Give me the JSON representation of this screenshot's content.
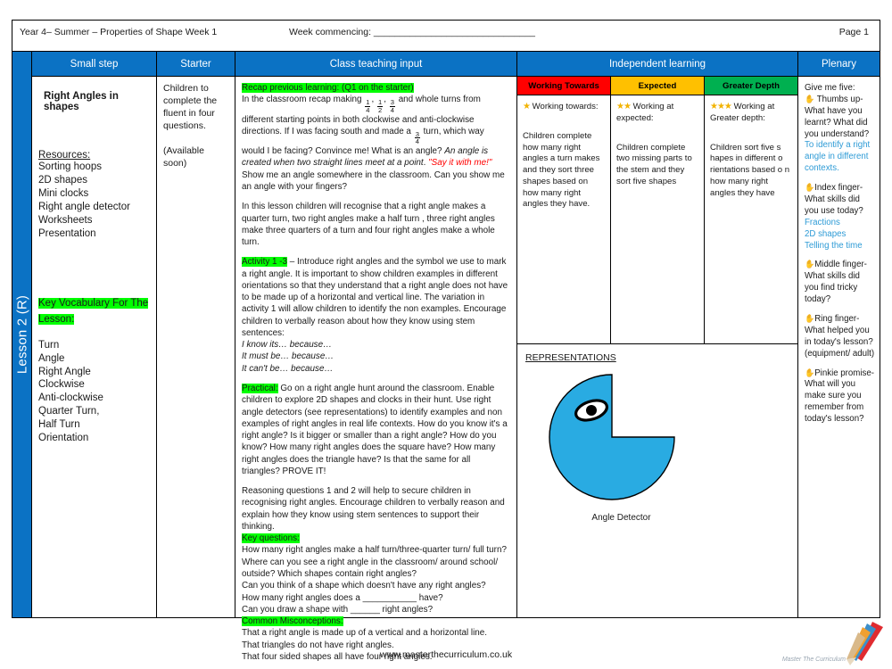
{
  "header": {
    "left": "Year 4– Summer – Properties of Shape Week 1",
    "middle": "Week commencing: _______________________________",
    "right": "Page 1"
  },
  "spine": {
    "label": "Lesson 2 (R)"
  },
  "columns": {
    "small_step": "Small step",
    "starter": "Starter",
    "class_teaching_input": "Class teaching input",
    "independent_learning": "Independent learning",
    "plenary": "Plenary"
  },
  "small_step": {
    "title": "Right Angles in shapes",
    "resources_heading": "Resources:",
    "resources": [
      "Sorting hoops",
      "2D shapes",
      "Mini clocks",
      "Right angle detector",
      "Worksheets",
      "Presentation"
    ],
    "vocab_heading": "Key Vocabulary For The Lesson:",
    "vocab": [
      "Turn",
      "Angle",
      "Right Angle",
      "Clockwise",
      "Anti-clockwise",
      "Quarter Turn,",
      "Half Turn",
      "Orientation"
    ]
  },
  "starter": {
    "text": "Children to complete the fluent in four questions.",
    "availability": "(Available soon)"
  },
  "teaching": {
    "recap_label": "Recap previous learning: (Q1 on the starter)",
    "recap_a": "In the classroom recap making",
    "frac1": {
      "num": "1",
      "den": "4"
    },
    "frac2": {
      "num": "1",
      "den": "2"
    },
    "frac3": {
      "num": "3",
      "den": "4"
    },
    "recap_b": "and whole turns from different starting points in both clockwise and anti-clockwise directions.  If I was facing south and made a",
    "frac4": {
      "num": "3",
      "den": "4"
    },
    "recap_c": "turn, which way would I be facing?  Convince me!  What is an angle?",
    "definition": "An angle is created when two straight lines meet at a point",
    "recap_d": ".",
    "say_it": "\"Say it with me!\"",
    "recap_e": "Show me an angle somewhere in the classroom.  Can you show me an angle with your fingers?",
    "para2": "In this lesson children will  recognise that a right angle makes a quarter turn, two right angles make a half turn , three right angles make three quarters of a turn and four right angles make a whole turn.",
    "activity_label": "Activity 1 -3",
    "activity_text": "– Introduce right angles and the symbol we use to mark a right angle.  It is important to show children examples in different orientations so that they understand that a right angle does not have to be made up of a horizontal and vertical line. The variation in activity 1 will allow children to identify the non examples.  Encourage children to verbally reason about how they know using stem sentences:",
    "stems": [
      "I know its… because…",
      "It must be… because…",
      "It can't be… because…"
    ],
    "practical_label": "Practical:",
    "practical_text": "Go on a right angle hunt around the classroom. Enable children to explore  2D shapes and clocks in their hunt.  Use right angle detectors (see representations) to identify examples and non examples of  right angles in real life contexts.  How do you know it's a right angle?  Is it bigger or smaller than a right angle?  How do you know?  How many right angles does the square have?  How many right angles does the triangle have?   Is that the same for all triangles? PROVE IT!",
    "reasoning": "Reasoning questions 1 and 2 will  help to secure children in recognising right angles.  Encourage children to verbally reason and explain how they know using stem sentences to support their thinking.",
    "key_questions_label": "Key questions:",
    "key_questions": [
      "How many right angles make a half turn/three-quarter turn/ full turn?",
      "Where can you see a right angle in the classroom/ around school/ outside? Which shapes contain right angles?",
      "Can you think of a shape which doesn't have any right angles?",
      "How many right angles does a ___________ have?",
      "Can you draw a shape with ______ right angles?"
    ],
    "misconceptions_label": " Common Misconceptions:",
    "misconceptions": [
      "That a right angle is made up of a vertical and a horizontal line.",
      "That  triangles do not have right angles.",
      "That four sided shapes all have four right angles."
    ]
  },
  "independent": {
    "bands": [
      {
        "head": "Working Towards",
        "head_color": "#ff0000",
        "stars": "★",
        "subtitle": "Working towards:",
        "body": "Children complete how many right angles a turn makes and they sort three shapes based on how many right angles they have."
      },
      {
        "head": "Expected",
        "head_color": "#ffc000",
        "stars": "★★",
        "subtitle": "Working at expected:",
        "body": "Children complete two missing parts to the stem and they sort five shapes"
      },
      {
        "head": "Greater Depth",
        "head_color": "#00b050",
        "stars": "★★★",
        "subtitle": "Working at Greater depth:",
        "body": "Children sort five s hapes in different o rientations based o n how many right angles they have"
      }
    ],
    "representations_title": "REPRESENTATIONS",
    "figure_caption": "Angle Detector",
    "figure_color": "#29abe2"
  },
  "plenary": {
    "intro": "Give me five:",
    "items": [
      {
        "hand": "✋",
        "prompt": "Thumbs up- What have you learnt? What did you understand?",
        "answers": [
          "To identify a right angle in different contexts."
        ]
      },
      {
        "hand": "✋",
        "prompt": "Index finger- What skills did you use today?",
        "answers": [
          "Fractions",
          "2D shapes",
          "Telling the time"
        ]
      },
      {
        "hand": "✋",
        "prompt": "Middle finger- What skills did you find tricky today?",
        "answers": []
      },
      {
        "hand": "✋",
        "prompt": "Ring finger- What helped you in today's lesson? (equipment/ adult)",
        "answers": []
      },
      {
        "hand": "✋",
        "prompt": "Pinkie promise- What will you make sure you remember from today's lesson?",
        "answers": []
      }
    ]
  },
  "footer": {
    "url": "www.masterthecurriculum.co.uk",
    "logo_text": "Master The Curriculum"
  },
  "theme": {
    "brand_blue": "#0b72c4",
    "highlight_green": "#00ff00",
    "answer_blue": "#2e9bd6",
    "red": "#ff0000"
  }
}
